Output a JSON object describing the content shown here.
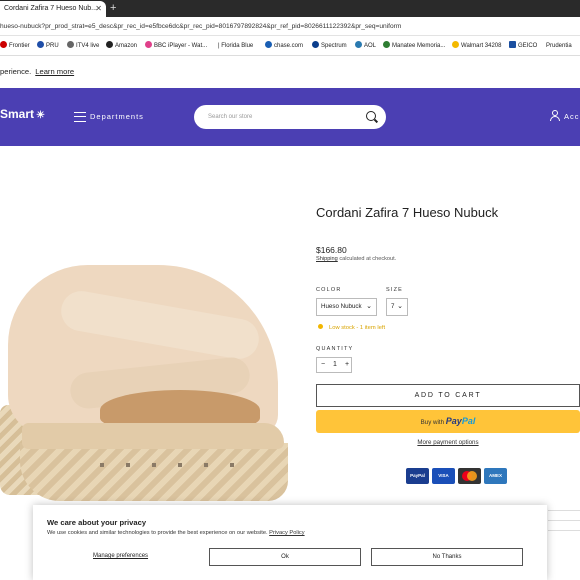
{
  "browser": {
    "tab_title": "Cordani Zafira 7 Hueso Nub...",
    "new_tab": "+",
    "url": "hueso-nubuck?pr_prod_strat=e5_desc&pr_rec_id=e5fbce6dc&pr_rec_pid=8016797892824&pr_ref_pid=8026611122392&pr_seq=uniform",
    "bookmarks": [
      "Frontier",
      "PRU",
      "ITV4 live",
      "Amazon",
      "BBC iPlayer - Wat...",
      "| Florida Blue",
      "chase.com",
      "Spectrum",
      "AOL",
      "Manatee Memoria...",
      "Walmart 34208",
      "GEICO",
      "Prudentia"
    ]
  },
  "notice": {
    "text": "perience.",
    "link": "Learn more"
  },
  "header": {
    "logo": "Smart",
    "departments": "Departments",
    "search_placeholder": "Search our store",
    "account": "Acc"
  },
  "product": {
    "title": "Cordani Zafira 7 Hueso Nubuck",
    "price": "$166.80",
    "shipping_link": "Shipping",
    "shipping_text": " calculated at checkout.",
    "color_label": "COLOR",
    "color_value": "Hueso Nubuck",
    "size_label": "SIZE",
    "size_value": "7",
    "stock": "Low stock - 1 item left",
    "quantity_label": "QUANTITY",
    "quantity": "1",
    "add_to_cart": "ADD TO CART",
    "paypal_prefix": "Buy with",
    "more_payment": "More payment options",
    "cards": [
      "PayPal",
      "VISA",
      "MC",
      "AMEX"
    ]
  },
  "colors": {
    "header_bg": "#4b3fb3",
    "paypal_bg": "#ffc439",
    "stock": "#d9a400"
  },
  "cookie": {
    "title": "We care about your privacy",
    "text": "We use cookies and similar technologies to provide the best experience on our website.",
    "policy_link": "Privacy Policy",
    "manage": "Manage preferences",
    "ok": "Ok",
    "no_thanks": "No Thanks"
  }
}
